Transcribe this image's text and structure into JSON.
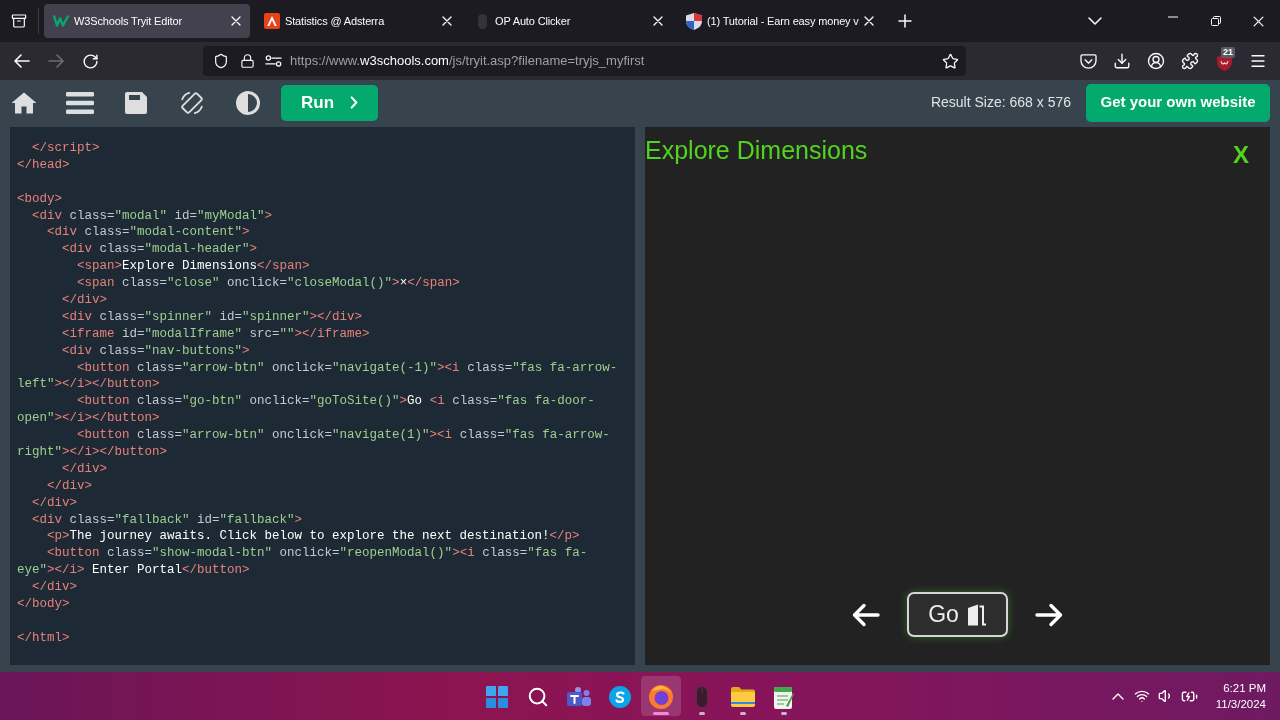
{
  "browser": {
    "tabs": [
      {
        "title": "W3Schools Tryit Editor",
        "kind": "zigzag",
        "selected": true
      },
      {
        "title": "Statistics @ Adsterra",
        "kind": "triangle",
        "selected": false
      },
      {
        "title": "OP Auto Clicker",
        "kind": "pill",
        "selected": false
      },
      {
        "title": "(1) Tutorial - Earn easy money v",
        "kind": "shield",
        "selected": false
      }
    ],
    "nav_buttons": [
      {
        "kind": "back",
        "disabled": false
      },
      {
        "kind": "forward",
        "disabled": true
      },
      {
        "kind": "reload",
        "disabled": false
      }
    ],
    "address_bar": {
      "url_prefix": "https://www.",
      "url_domain": "w3schools.com",
      "url_path": "/js/tryit.asp?filename=tryjs_myfirst"
    },
    "extension_badge": "21"
  },
  "toolbar": {
    "run_button": "Run",
    "result_size": "Result Size: 668 x 576",
    "cta_button": "Get your own website"
  },
  "editor": {
    "blocks": [
      [
        {
          "tokens": [
            {
              "kind": "tag",
              "text": "  </script>"
            }
          ]
        },
        {
          "tokens": [
            {
              "kind": "tag",
              "text": "</head>"
            }
          ]
        }
      ],
      [
        {
          "tokens": [
            {
              "kind": "tag",
              "text": "<body>"
            }
          ]
        },
        {
          "tokens": [
            {
              "kind": "tag",
              "text": "  <div"
            },
            {
              "kind": "attr",
              "text": " class="
            },
            {
              "kind": "value",
              "text": "\"modal\""
            },
            {
              "kind": "attr",
              "text": " id="
            },
            {
              "kind": "value",
              "text": "\"myModal\""
            },
            {
              "kind": "tag",
              "text": ">"
            }
          ]
        },
        {
          "tokens": [
            {
              "kind": "tag",
              "text": "    <div"
            },
            {
              "kind": "attr",
              "text": " class="
            },
            {
              "kind": "value",
              "text": "\"modal-content\""
            },
            {
              "kind": "tag",
              "text": ">"
            }
          ]
        },
        {
          "tokens": [
            {
              "kind": "tag",
              "text": "      <div"
            },
            {
              "kind": "attr",
              "text": " class="
            },
            {
              "kind": "value",
              "text": "\"modal-header\""
            },
            {
              "kind": "tag",
              "text": ">"
            }
          ]
        },
        {
          "tokens": [
            {
              "kind": "tag",
              "text": "        <span>"
            },
            {
              "kind": "text",
              "text": "Explore Dimensions"
            },
            {
              "kind": "tag",
              "text": "</span>"
            }
          ]
        },
        {
          "tokens": [
            {
              "kind": "tag",
              "text": "        <span"
            },
            {
              "kind": "attr",
              "text": " class="
            },
            {
              "kind": "value",
              "text": "\"close\""
            },
            {
              "kind": "attr",
              "text": " onclick="
            },
            {
              "kind": "value",
              "text": "\"closeModal()\""
            },
            {
              "kind": "tag",
              "text": ">"
            },
            {
              "kind": "text",
              "text": "×"
            },
            {
              "kind": "tag",
              "text": "</span>"
            }
          ]
        },
        {
          "tokens": [
            {
              "kind": "tag",
              "text": "      </div>"
            }
          ]
        },
        {
          "tokens": [
            {
              "kind": "tag",
              "text": "      <div"
            },
            {
              "kind": "attr",
              "text": " class="
            },
            {
              "kind": "value",
              "text": "\"spinner\""
            },
            {
              "kind": "attr",
              "text": " id="
            },
            {
              "kind": "value",
              "text": "\"spinner\""
            },
            {
              "kind": "tag",
              "text": "></div>"
            }
          ]
        },
        {
          "tokens": [
            {
              "kind": "tag",
              "text": "      <iframe"
            },
            {
              "kind": "attr",
              "text": " id="
            },
            {
              "kind": "value",
              "text": "\"modalIframe\""
            },
            {
              "kind": "attr",
              "text": " src="
            },
            {
              "kind": "value",
              "text": "\"\""
            },
            {
              "kind": "tag",
              "text": "></iframe>"
            }
          ]
        },
        {
          "tokens": [
            {
              "kind": "tag",
              "text": "      <div"
            },
            {
              "kind": "attr",
              "text": " class="
            },
            {
              "kind": "value",
              "text": "\"nav-buttons\""
            },
            {
              "kind": "tag",
              "text": ">"
            }
          ]
        },
        {
          "tokens": [
            {
              "kind": "tag",
              "text": "        <button"
            },
            {
              "kind": "attr",
              "text": " class="
            },
            {
              "kind": "value",
              "text": "\"arrow-btn\""
            },
            {
              "kind": "attr",
              "text": " onclick="
            },
            {
              "kind": "value",
              "text": "\"navigate(-1)\""
            },
            {
              "kind": "tag",
              "text": "><i"
            },
            {
              "kind": "attr",
              "text": " class="
            },
            {
              "kind": "value",
              "text": "\"fas fa-arrow-"
            }
          ]
        },
        {
          "tokens": [
            {
              "kind": "value",
              "text": "left\""
            },
            {
              "kind": "tag",
              "text": "></i></button>"
            }
          ]
        },
        {
          "tokens": [
            {
              "kind": "tag",
              "text": "        <button"
            },
            {
              "kind": "attr",
              "text": " class="
            },
            {
              "kind": "value",
              "text": "\"go-btn\""
            },
            {
              "kind": "attr",
              "text": " onclick="
            },
            {
              "kind": "value",
              "text": "\"goToSite()\""
            },
            {
              "kind": "tag",
              "text": ">"
            },
            {
              "kind": "text",
              "text": "Go "
            },
            {
              "kind": "tag",
              "text": "<i"
            },
            {
              "kind": "attr",
              "text": " class="
            },
            {
              "kind": "value",
              "text": "\"fas fa-door-"
            }
          ]
        },
        {
          "tokens": [
            {
              "kind": "value",
              "text": "open\""
            },
            {
              "kind": "tag",
              "text": "></i></button>"
            }
          ]
        },
        {
          "tokens": [
            {
              "kind": "tag",
              "text": "        <button"
            },
            {
              "kind": "attr",
              "text": " class="
            },
            {
              "kind": "value",
              "text": "\"arrow-btn\""
            },
            {
              "kind": "attr",
              "text": " onclick="
            },
            {
              "kind": "value",
              "text": "\"navigate(1)\""
            },
            {
              "kind": "tag",
              "text": "><i"
            },
            {
              "kind": "attr",
              "text": " class="
            },
            {
              "kind": "value",
              "text": "\"fas fa-arrow-"
            }
          ]
        },
        {
          "tokens": [
            {
              "kind": "value",
              "text": "right\""
            },
            {
              "kind": "tag",
              "text": "></i></button>"
            }
          ]
        },
        {
          "tokens": [
            {
              "kind": "tag",
              "text": "      </div>"
            }
          ]
        },
        {
          "tokens": [
            {
              "kind": "tag",
              "text": "    </div>"
            }
          ]
        },
        {
          "tokens": [
            {
              "kind": "tag",
              "text": "  </div>"
            }
          ]
        },
        {
          "tokens": [
            {
              "kind": "tag",
              "text": "  <div"
            },
            {
              "kind": "attr",
              "text": " class="
            },
            {
              "kind": "value",
              "text": "\"fallback\""
            },
            {
              "kind": "attr",
              "text": " id="
            },
            {
              "kind": "value",
              "text": "\"fallback\""
            },
            {
              "kind": "tag",
              "text": ">"
            }
          ]
        },
        {
          "tokens": [
            {
              "kind": "tag",
              "text": "    <p>"
            },
            {
              "kind": "text",
              "text": "The journey awaits. Click below to explore the next destination!"
            },
            {
              "kind": "tag",
              "text": "</p>"
            }
          ]
        },
        {
          "tokens": [
            {
              "kind": "tag",
              "text": "    <button"
            },
            {
              "kind": "attr",
              "text": " class="
            },
            {
              "kind": "value",
              "text": "\"show-modal-btn\""
            },
            {
              "kind": "attr",
              "text": " onclick="
            },
            {
              "kind": "value",
              "text": "\"reopenModal()\""
            },
            {
              "kind": "tag",
              "text": "><i"
            },
            {
              "kind": "attr",
              "text": " class="
            },
            {
              "kind": "value",
              "text": "\"fas fa-"
            }
          ]
        },
        {
          "tokens": [
            {
              "kind": "value",
              "text": "eye\""
            },
            {
              "kind": "tag",
              "text": "></i>"
            },
            {
              "kind": "text",
              "text": " Enter Portal"
            },
            {
              "kind": "tag",
              "text": "</button>"
            }
          ]
        },
        {
          "tokens": [
            {
              "kind": "tag",
              "text": "  </div>"
            }
          ]
        },
        {
          "tokens": [
            {
              "kind": "tag",
              "text": "</body>"
            }
          ]
        }
      ],
      [
        {
          "tokens": [
            {
              "kind": "tag",
              "text": "</html>"
            }
          ]
        }
      ]
    ]
  },
  "result": {
    "title": "Explore Dimensions",
    "close": "X",
    "go_button": "Go"
  },
  "taskbar": {
    "apps": [
      {
        "kind": "start",
        "selected": false,
        "running": false
      },
      {
        "kind": "search",
        "selected": false,
        "running": false
      },
      {
        "kind": "people",
        "selected": false,
        "running": false
      },
      {
        "kind": "swirl",
        "selected": false,
        "running": false
      },
      {
        "kind": "globe",
        "selected": true,
        "running": true
      },
      {
        "kind": "mouse",
        "selected": false,
        "running": true
      },
      {
        "kind": "folder",
        "selected": false,
        "running": true
      },
      {
        "kind": "notepad",
        "selected": false,
        "running": true
      }
    ],
    "time": "6:21 PM",
    "date": "11/3/2024"
  }
}
